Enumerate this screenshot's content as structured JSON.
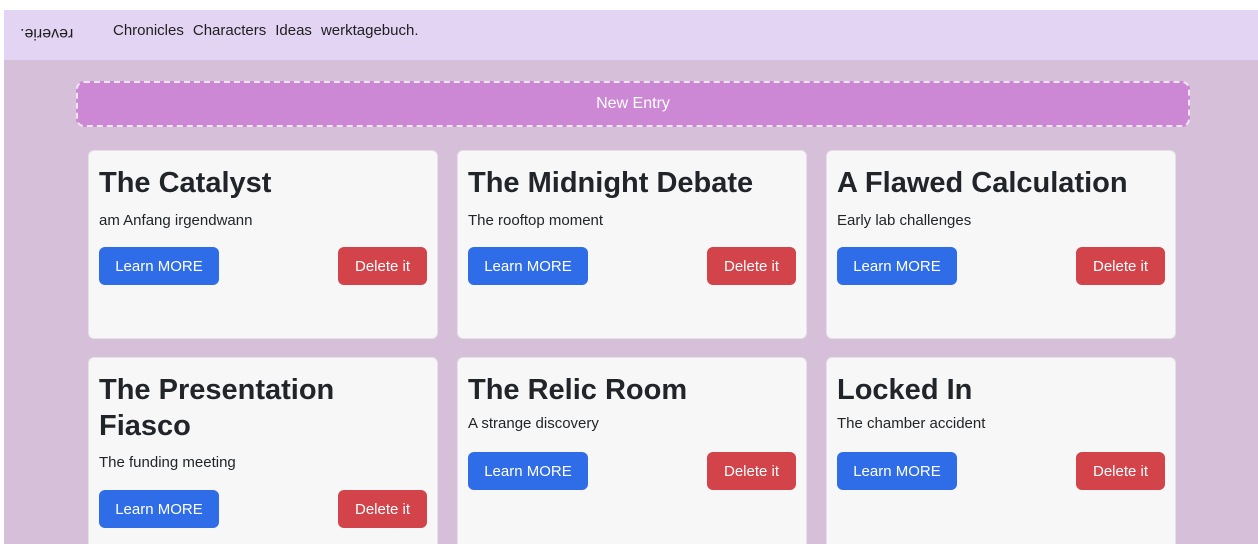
{
  "navbar": {
    "brand": "reverie.",
    "links": [
      "Chronicles",
      "Characters",
      "Ideas",
      "werktagebuch."
    ]
  },
  "new_entry_label": "New Entry",
  "cards": [
    {
      "title": "The Catalyst",
      "subtitle": "am Anfang irgendwann",
      "learn_label": "Learn MORE",
      "delete_label": "Delete it"
    },
    {
      "title": "The Midnight Debate",
      "subtitle": "The rooftop moment",
      "learn_label": "Learn MORE",
      "delete_label": "Delete it"
    },
    {
      "title": "A Flawed Calculation",
      "subtitle": "Early lab challenges",
      "learn_label": "Learn MORE",
      "delete_label": "Delete it"
    },
    {
      "title": "The Presentation Fiasco",
      "subtitle": "The funding meeting",
      "learn_label": "Learn MORE",
      "delete_label": "Delete it"
    },
    {
      "title": "The Relic Room",
      "subtitle": "A strange discovery",
      "learn_label": "Learn MORE",
      "delete_label": "Delete it"
    },
    {
      "title": "Locked In",
      "subtitle": "The chamber accident",
      "learn_label": "Learn MORE",
      "delete_label": "Delete it"
    }
  ],
  "colors": {
    "page_bg": "#d6bfd8",
    "navbar_bg": "#e3d4f4",
    "new_entry_bg": "#cc88d4",
    "learn_button": "#2f6de8",
    "delete_button": "#d2434a"
  }
}
